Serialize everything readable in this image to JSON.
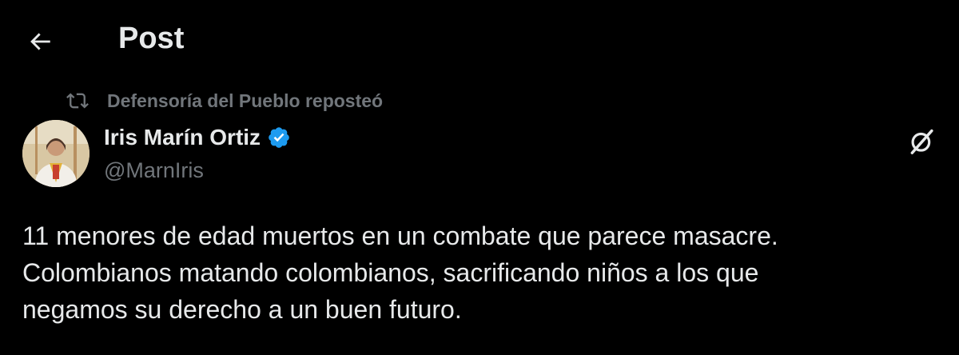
{
  "header": {
    "back_icon": "arrow-left-icon",
    "title": "Post"
  },
  "repost": {
    "icon": "repost-icon",
    "text": "Defensoría del Pueblo reposteó"
  },
  "author": {
    "name": "Iris Marín Ortiz",
    "handle": "@MarnIris",
    "verified": true,
    "verified_color": "#1d9bf0"
  },
  "actions": {
    "grok_icon": "grok-slash-icon"
  },
  "tweet": {
    "lines": [
      "11 menores de edad muertos en un combate que parece masacre.",
      "Colombianos matando colombianos, sacrificando niños a los que",
      "negamos su derecho a un buen futuro."
    ]
  },
  "colors": {
    "background": "#000000",
    "text_primary": "#e7e9ea",
    "text_secondary": "#71767b"
  }
}
